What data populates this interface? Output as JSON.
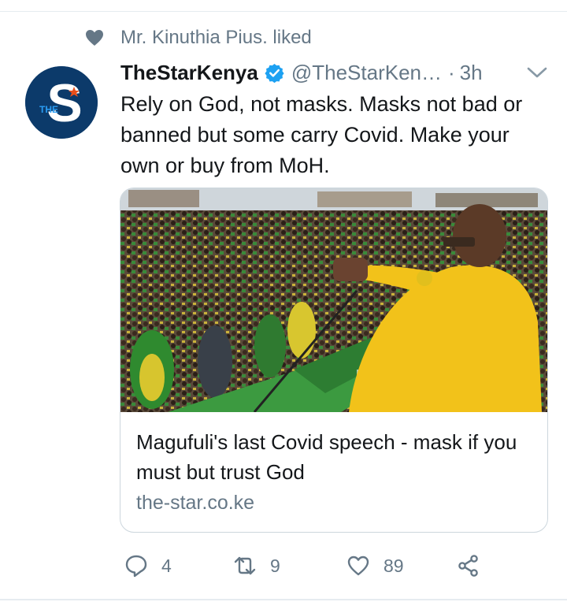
{
  "social_context": {
    "icon": "heart-icon",
    "text": "Mr. Kinuthia Pius. liked"
  },
  "tweet": {
    "avatar_letter": "S",
    "avatar_small_text": "THE",
    "display_name": "TheStarKenya",
    "verified_icon": "verified-badge-icon",
    "handle": "@TheStarKen…",
    "separator": "·",
    "time": "3h",
    "text": "Rely on God, not masks. Masks not bad or banned but some carry Covid. Make your own or buy from MoH."
  },
  "card": {
    "image": "photo-speaker-addressing-crowd",
    "title": "Magufuli's last Covid speech - mask if you must but trust God",
    "domain": "the-star.co.ke"
  },
  "actions": {
    "reply": {
      "icon": "reply-icon",
      "count": "4"
    },
    "retweet": {
      "icon": "retweet-icon",
      "count": "9"
    },
    "like": {
      "icon": "heart-outline-icon",
      "count": "89"
    },
    "share": {
      "icon": "share-icon"
    }
  },
  "colors": {
    "text_primary": "#14171a",
    "text_secondary": "#657786",
    "verified_blue": "#1da1f2",
    "avatar_bg": "#0c3a6a",
    "border": "#ccd6dd"
  }
}
